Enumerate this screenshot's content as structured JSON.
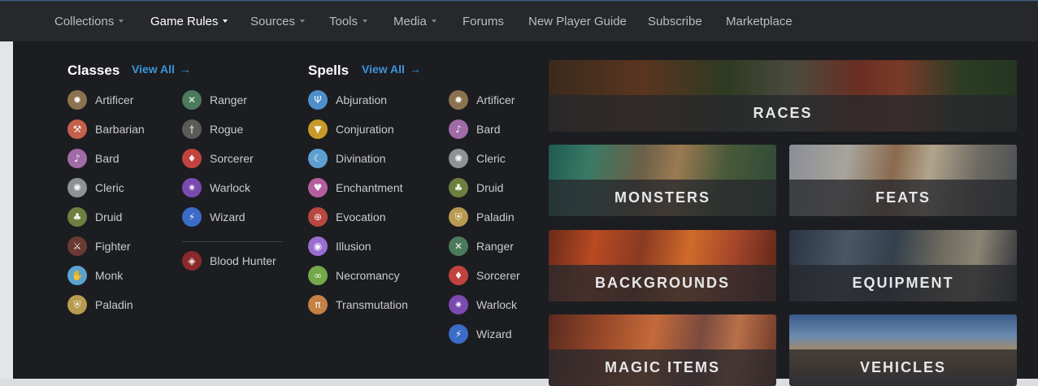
{
  "nav": {
    "items": [
      {
        "label": "Collections",
        "dropdown": true,
        "active": false
      },
      {
        "label": "Game Rules",
        "dropdown": true,
        "active": true
      },
      {
        "label": "Sources",
        "dropdown": true,
        "active": false
      },
      {
        "label": "Tools",
        "dropdown": true,
        "active": false
      },
      {
        "label": "Media",
        "dropdown": true,
        "active": false
      },
      {
        "label": "Forums",
        "dropdown": false,
        "active": false
      },
      {
        "label": "New Player Guide",
        "dropdown": false,
        "active": false
      },
      {
        "label": "Subscribe",
        "dropdown": false,
        "active": false
      },
      {
        "label": "Marketplace",
        "dropdown": false,
        "active": false
      }
    ]
  },
  "classes": {
    "title": "Classes",
    "view_all": "View All",
    "items": [
      {
        "label": "Artificer",
        "icon": "artificer-icon",
        "color": "#8b7350",
        "glyph": "✹"
      },
      {
        "label": "Barbarian",
        "icon": "barbarian-icon",
        "color": "#c4614c",
        "glyph": "⚒"
      },
      {
        "label": "Bard",
        "icon": "bard-icon",
        "color": "#a06ba6",
        "glyph": "♪"
      },
      {
        "label": "Cleric",
        "icon": "cleric-icon",
        "color": "#8e9297",
        "glyph": "✺"
      },
      {
        "label": "Druid",
        "icon": "druid-icon",
        "color": "#6e8040",
        "glyph": "♣"
      },
      {
        "label": "Fighter",
        "icon": "fighter-icon",
        "color": "#6b3a33",
        "glyph": "⚔"
      },
      {
        "label": "Monk",
        "icon": "monk-icon",
        "color": "#5aa3d0",
        "glyph": "✋"
      },
      {
        "label": "Paladin",
        "icon": "paladin-icon",
        "color": "#b89a50",
        "glyph": "⛨"
      },
      {
        "label": "Ranger",
        "icon": "ranger-icon",
        "color": "#4c7a5c",
        "glyph": "✕"
      },
      {
        "label": "Rogue",
        "icon": "rogue-icon",
        "color": "#5a5b56",
        "glyph": "†"
      },
      {
        "label": "Sorcerer",
        "icon": "sorcerer-icon",
        "color": "#c0433f",
        "glyph": "♦"
      },
      {
        "label": "Warlock",
        "icon": "warlock-icon",
        "color": "#7b4ab0",
        "glyph": "✷"
      },
      {
        "label": "Wizard",
        "icon": "wizard-icon",
        "color": "#3a6cc8",
        "glyph": "⚡"
      },
      {
        "label": "Blood Hunter",
        "icon": "blood-hunter-icon",
        "color": "#8a2a2a",
        "glyph": "◈"
      }
    ]
  },
  "spells": {
    "title": "Spells",
    "view_all": "View All",
    "schools": [
      {
        "label": "Abjuration",
        "icon": "abjuration-icon",
        "color": "#4e8fc9",
        "glyph": "Ψ"
      },
      {
        "label": "Conjuration",
        "icon": "conjuration-icon",
        "color": "#c99a2a",
        "glyph": "▼"
      },
      {
        "label": "Divination",
        "icon": "divination-icon",
        "color": "#5f9ed0",
        "glyph": "☾"
      },
      {
        "label": "Enchantment",
        "icon": "enchantment-icon",
        "color": "#b35f9e",
        "glyph": "♥"
      },
      {
        "label": "Evocation",
        "icon": "evocation-icon",
        "color": "#b8473f",
        "glyph": "⊕"
      },
      {
        "label": "Illusion",
        "icon": "illusion-icon",
        "color": "#9a6ed0",
        "glyph": "◉"
      },
      {
        "label": "Necromancy",
        "icon": "necromancy-icon",
        "color": "#74a848",
        "glyph": "∞"
      },
      {
        "label": "Transmutation",
        "icon": "transmutation-icon",
        "color": "#c58046",
        "glyph": "π"
      }
    ],
    "classes": [
      {
        "label": "Artificer",
        "icon": "artificer-icon",
        "color": "#8b7350",
        "glyph": "✹"
      },
      {
        "label": "Bard",
        "icon": "bard-icon",
        "color": "#a06ba6",
        "glyph": "♪"
      },
      {
        "label": "Cleric",
        "icon": "cleric-icon",
        "color": "#8e9297",
        "glyph": "✺"
      },
      {
        "label": "Druid",
        "icon": "druid-icon",
        "color": "#6e8040",
        "glyph": "♣"
      },
      {
        "label": "Paladin",
        "icon": "paladin-icon",
        "color": "#b89a50",
        "glyph": "⛨"
      },
      {
        "label": "Ranger",
        "icon": "ranger-icon",
        "color": "#4c7a5c",
        "glyph": "✕"
      },
      {
        "label": "Sorcerer",
        "icon": "sorcerer-icon",
        "color": "#c0433f",
        "glyph": "♦"
      },
      {
        "label": "Warlock",
        "icon": "warlock-icon",
        "color": "#7b4ab0",
        "glyph": "✷"
      },
      {
        "label": "Wizard",
        "icon": "wizard-icon",
        "color": "#3a6cc8",
        "glyph": "⚡"
      }
    ]
  },
  "cards": [
    {
      "label": "RACES",
      "background": "linear-gradient(90deg,#3a2a1c 0%,#5a3520 20%,#2f3a22 38%,#4a4b3e 52%,#6a2e22 66%,#7a3a2a 75%,#2c3d24 88%,#233620 100%)"
    },
    {
      "label": "MONSTERS",
      "background": "linear-gradient(100deg,#1f5a52 0%,#3a7a64 18%,#6b6048 40%,#9a7a52 55%,#4a5a3a 75%,#2c4a36 100%)"
    },
    {
      "label": "FEATS",
      "background": "linear-gradient(100deg,#8a8e96 0%,#a8a49c 25%,#8a6a4e 45%,#b0a48c 60%,#6e6a62 80%,#4a4e52 100%)"
    },
    {
      "label": "BACKGROUNDS",
      "background": "linear-gradient(100deg,#6a2a1a 0%,#b84a22 20%,#8a3a22 40%,#d06a2a 60%,#a0442a 80%,#5a2418 100%)"
    },
    {
      "label": "EQUIPMENT",
      "background": "linear-gradient(100deg,#2a3442 0%,#4a5666 25%,#34404c 45%,#6e6a5e 65%,#8a8474 80%,#2e3238 100%)"
    },
    {
      "label": "MAGIC ITEMS",
      "background": "linear-gradient(100deg,#5a2a1e 0%,#9a4a2a 25%,#c46a3a 45%,#7a4a3e 65%,#b8704a 80%,#6a3424 100%)"
    },
    {
      "label": "VEHICLES",
      "background": "linear-gradient(180deg,#3a5a8a 0%,#6a8ab0 30%,#b08a5a 55%,#8a6a4a 75%,#4a4a52 100%)"
    }
  ]
}
